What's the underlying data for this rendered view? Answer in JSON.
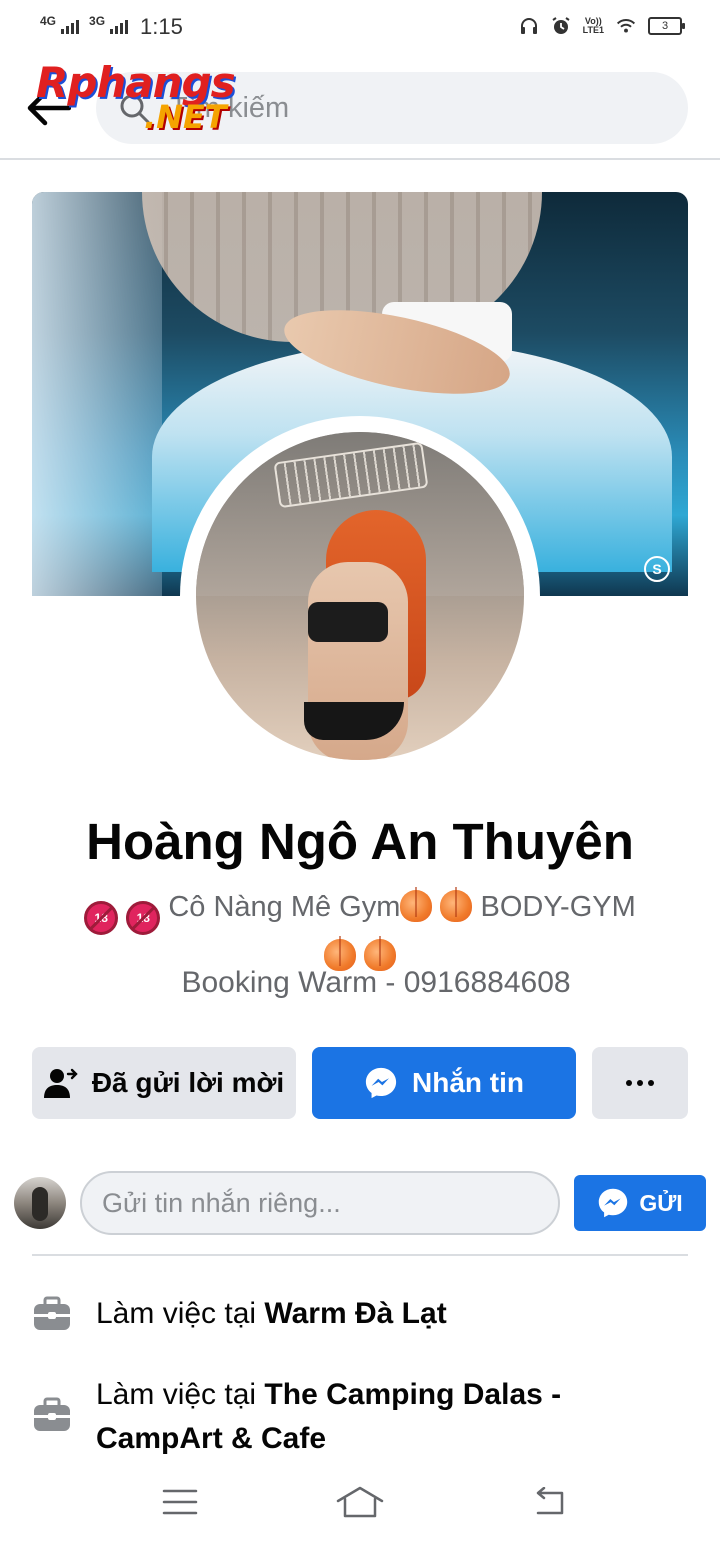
{
  "status_bar": {
    "sim1": "4G",
    "sim2": "3G",
    "time": "1:15",
    "volte_line1": "Vo))",
    "volte_line2": "LTE1",
    "battery": "3"
  },
  "header": {
    "search_placeholder": "Tìm kiếm",
    "watermark_main": "Rphangs",
    "watermark_net": ".NET"
  },
  "profile": {
    "name": "Hoàng Ngô An Thuyên",
    "bio_emoji_18": "18",
    "bio_text": "Cô Nàng Mê Gym",
    "bio_tag": "BODY-GYM",
    "bio_contact": "Booking Warm - 0916884608",
    "cover_badge": "S"
  },
  "actions": {
    "request_sent_label": "Đã gửi lời mời",
    "message_label": "Nhắn tin"
  },
  "compose": {
    "placeholder": "Gửi tin nhắn riêng...",
    "send_label": "GỬI"
  },
  "work": [
    {
      "prefix": "Làm việc tại",
      "place": "Warm Đà Lạt"
    },
    {
      "prefix": "Làm việc tại",
      "place": "The Camping Dalas - CampArt & Cafe"
    }
  ],
  "colors": {
    "accent": "#1b74e4",
    "button_gray": "#e4e6eb",
    "secondary_text": "#65676b"
  },
  "icons": {
    "back": "arrow-left-icon",
    "search": "search-icon",
    "friend_sent": "person-check-icon",
    "messenger": "messenger-icon",
    "more": "more-dots-icon",
    "work": "briefcase-icon",
    "nav_menu": "menu-icon",
    "nav_home": "home-icon",
    "nav_back": "back-nav-icon"
  }
}
